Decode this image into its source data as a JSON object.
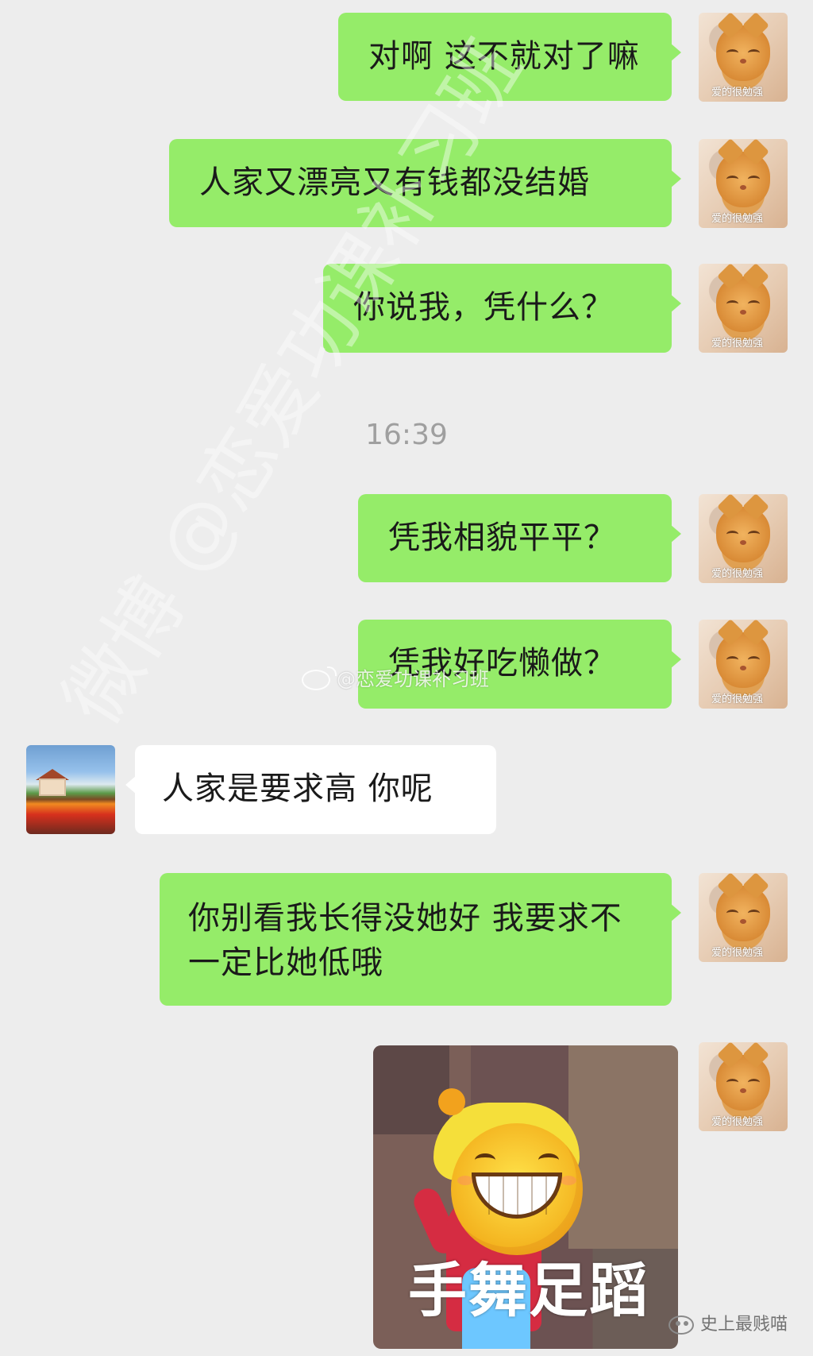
{
  "chat": {
    "timestamp": "16:39",
    "messages": [
      {
        "text": "对啊 这不就对了嘛"
      },
      {
        "text": "人家又漂亮又有钱都没结婚"
      },
      {
        "text": "你说我，凭什么？"
      },
      {
        "text": "凭我相貌平平？"
      },
      {
        "text": "凭我好吃懒做？"
      },
      {
        "text": "人家是要求高 你呢"
      },
      {
        "text": "你别看我长得没她好 我要求不一定比她低哦"
      }
    ]
  },
  "avatars": {
    "me": {
      "tag": "爱的很勉强"
    }
  },
  "sticker": {
    "caption": "手舞足蹈"
  },
  "watermarks": {
    "center": "@恋爱功课补习班",
    "diagonal": "微博 @恋爱功课补习班"
  },
  "branding": {
    "text": "史上最贱喵"
  }
}
